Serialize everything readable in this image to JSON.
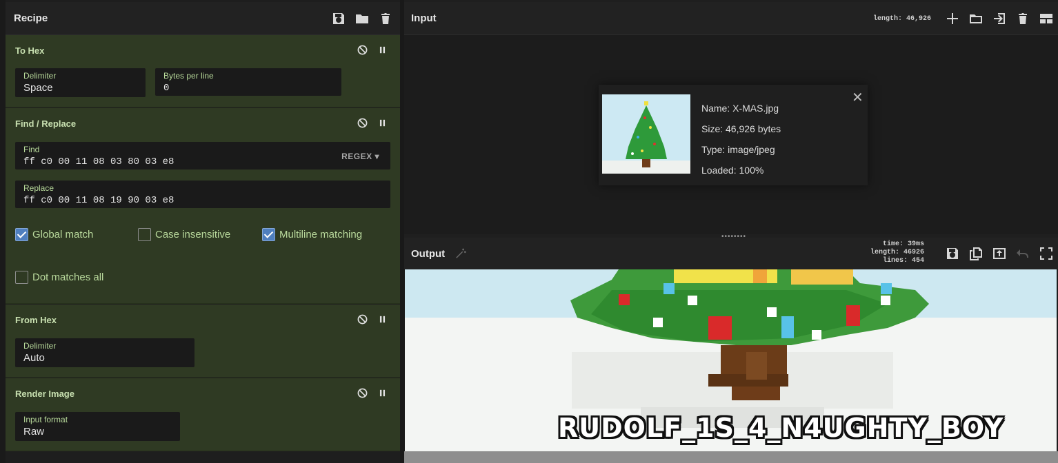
{
  "recipe": {
    "title": "Recipe",
    "operations": [
      {
        "name": "To Hex",
        "args": [
          {
            "label": "Delimiter",
            "value": "Space"
          },
          {
            "label": "Bytes per line",
            "value": "0"
          }
        ]
      },
      {
        "name": "Find / Replace",
        "find": {
          "label": "Find",
          "value": "ff c0 00 11 08 03 80 03 e8",
          "mode": "REGEX"
        },
        "replace": {
          "label": "Replace",
          "value": "ff c0 00 11 08 19 90 03 e8"
        },
        "options": [
          {
            "label": "Global match",
            "checked": true
          },
          {
            "label": "Case insensitive",
            "checked": false
          },
          {
            "label": "Multiline matching",
            "checked": true
          },
          {
            "label": "Dot matches all",
            "checked": false
          }
        ]
      },
      {
        "name": "From Hex",
        "args": [
          {
            "label": "Delimiter",
            "value": "Auto"
          }
        ]
      },
      {
        "name": "Render Image",
        "args": [
          {
            "label": "Input format",
            "value": "Raw"
          }
        ]
      }
    ]
  },
  "input": {
    "title": "Input",
    "length_label": "length: 46,926",
    "file": {
      "name": "Name: X-MAS.jpg",
      "size": "Size: 46,926 bytes",
      "type": "Type: image/jpeg",
      "loaded": "Loaded: 100%"
    }
  },
  "output": {
    "title": "Output",
    "stats": {
      "time": "time:  39ms",
      "length": "length: 46926",
      "lines": "lines:   454"
    },
    "flag_text": "RUDOLF_1S_4_N4UGHTY_BOY"
  },
  "icons": {
    "recipe": [
      "save-icon",
      "folder-icon",
      "trash-icon"
    ],
    "input": [
      "plus-icon",
      "folder-icon",
      "import-icon",
      "trash-icon",
      "layout-icon"
    ],
    "output": [
      "save-icon",
      "copy-icon",
      "replace-input-icon",
      "undo-icon",
      "maximize-icon"
    ]
  },
  "colors": {
    "op_background": "#2f3a23",
    "op_title": "#c8e0b0",
    "checkbox_on": "#4f7fbf"
  }
}
